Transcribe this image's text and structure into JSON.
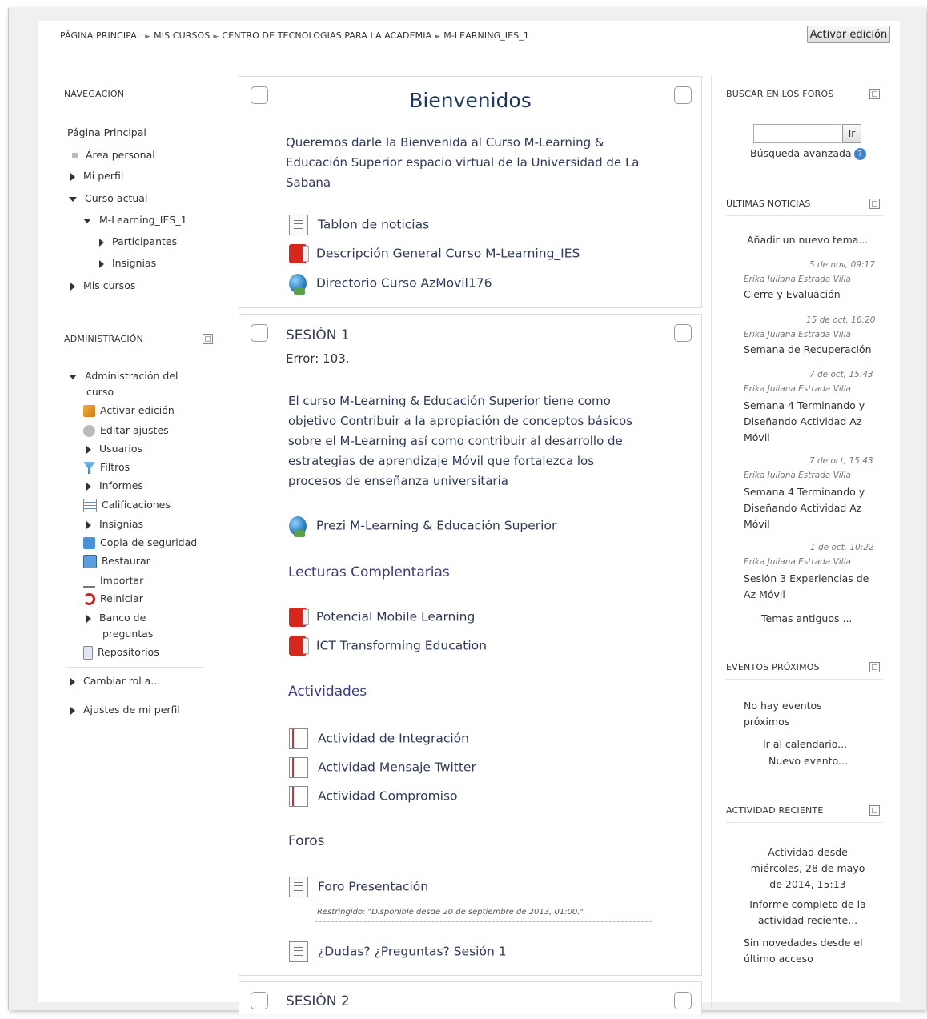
{
  "breadcrumb": [
    "PÁGINA PRINCIPAL",
    "MIS CURSOS",
    "CENTRO DE TECNOLOGIAS PARA LA ACADEMIA",
    "M-LEARNING_IES_1"
  ],
  "edit_button": "Activar edición",
  "navigation": {
    "title": "NAVEGACIÓN",
    "items": {
      "home": "Página Principal",
      "personal": "Área personal",
      "profile": "Mi perfil",
      "current": "Curso actual",
      "course": "M-Learning_IES_1",
      "participants": "Participantes",
      "badges": "Insignias",
      "mycourses": "Mis cursos"
    }
  },
  "administration": {
    "title": "ADMINISTRACIÓN",
    "items": {
      "course_admin": "Administración del",
      "course_admin2": "curso",
      "activate": "Activar edición",
      "settings": "Editar ajustes",
      "users": "Usuarios",
      "filters": "Filtros",
      "reports": "Informes",
      "grades": "Calificaciones",
      "badges": "Insignias",
      "backup": "Copia de seguridad",
      "restore": "Restaurar",
      "import": "Importar",
      "reset": "Reiniciar",
      "qbank": "Banco de",
      "qbank2": "preguntas",
      "repos": "Repositorios",
      "switch_role": "Cambiar rol a...",
      "my_profile": "Ajustes de mi perfil"
    }
  },
  "welcome": {
    "title": "Bienvenidos",
    "text_lines": [
      "Queremos darle la Bienvenida al Curso M-Learning &",
      "Educación Superior espacio virtual de la Universidad de La",
      "Sabana"
    ],
    "activities": [
      "Tablon de noticias",
      "Descripción General Curso M-Learning_IES",
      "Directorio Curso AzMovil176"
    ]
  },
  "session1": {
    "title": "SESIÓN 1",
    "error": "Error: 103.",
    "text_lines": [
      "El curso M-Learning & Educación Superior tiene como",
      "objetivo Contribuir a la apropiación de conceptos básicos",
      "sobre el M-Learning así como contribuir al desarrollo de",
      "estrategias de aprendizaje Móvil que fortalezca los",
      "procesos de enseñanza universitaria"
    ],
    "prezi": "Prezi M-Learning & Educación Superior",
    "readings_title": "Lecturas Complentarias",
    "readings": [
      "Potencial Mobile Learning",
      "ICT Transforming Education"
    ],
    "activities_title": "Actividades",
    "activities": [
      "Actividad de Integración",
      "Actividad Mensaje Twitter",
      "Actividad Compromiso"
    ],
    "forums_title": "Foros",
    "forum": "Foro Presentación",
    "restricted": "Restringido: \"Disponible desde 20 de septiembre de 2013, 01:00.\"",
    "questions": "¿Dudas? ¿Preguntas? Sesión 1"
  },
  "session2": {
    "title": "SESIÓN 2"
  },
  "search_forums": {
    "title": "BUSCAR EN LOS FOROS",
    "go": "Ir",
    "advanced": "Búsqueda avanzada"
  },
  "news": {
    "title": "ÚLTIMAS NOTICIAS",
    "add": "Añadir un nuevo tema...",
    "items": [
      {
        "date": "5 de nov, 09:17",
        "author": "Erika Juliana Estrada Villa",
        "subject": [
          "Cierre y Evaluación"
        ]
      },
      {
        "date": "15 de oct, 16:20",
        "author": "Erika Juliana Estrada Villa",
        "subject": [
          "Semana de Recuperación"
        ]
      },
      {
        "date": "7 de oct, 15:43",
        "author": "Erika Juliana Estrada Villa",
        "subject": [
          "Semana 4 Terminando y",
          "Diseñando Actividad Az",
          "Móvil"
        ]
      },
      {
        "date": "7 de oct, 15:43",
        "author": "Erika Juliana Estrada Villa",
        "subject": [
          "Semana 4 Terminando y",
          "Diseñando Actividad Az",
          "Móvil"
        ]
      },
      {
        "date": "1 de oct, 10:22",
        "author": "Erika Juliana Estrada Villa",
        "subject": [
          "Sesión 3 Experiencias de",
          "Az Móvil"
        ]
      }
    ],
    "older": "Temas antiguos ..."
  },
  "events": {
    "title": "EVENTOS PRÓXIMOS",
    "none1": "No hay eventos",
    "none2": "próximos",
    "calendar": "Ir al calendario...",
    "new": "Nuevo evento..."
  },
  "recent": {
    "title": "ACTIVIDAD RECIENTE",
    "since": [
      "Actividad desde",
      "miércoles, 28 de mayo",
      "de 2014, 15:13"
    ],
    "report": [
      "Informe completo de la",
      "actividad reciente..."
    ],
    "none": [
      "Sin novedades desde el",
      "último acceso"
    ]
  }
}
